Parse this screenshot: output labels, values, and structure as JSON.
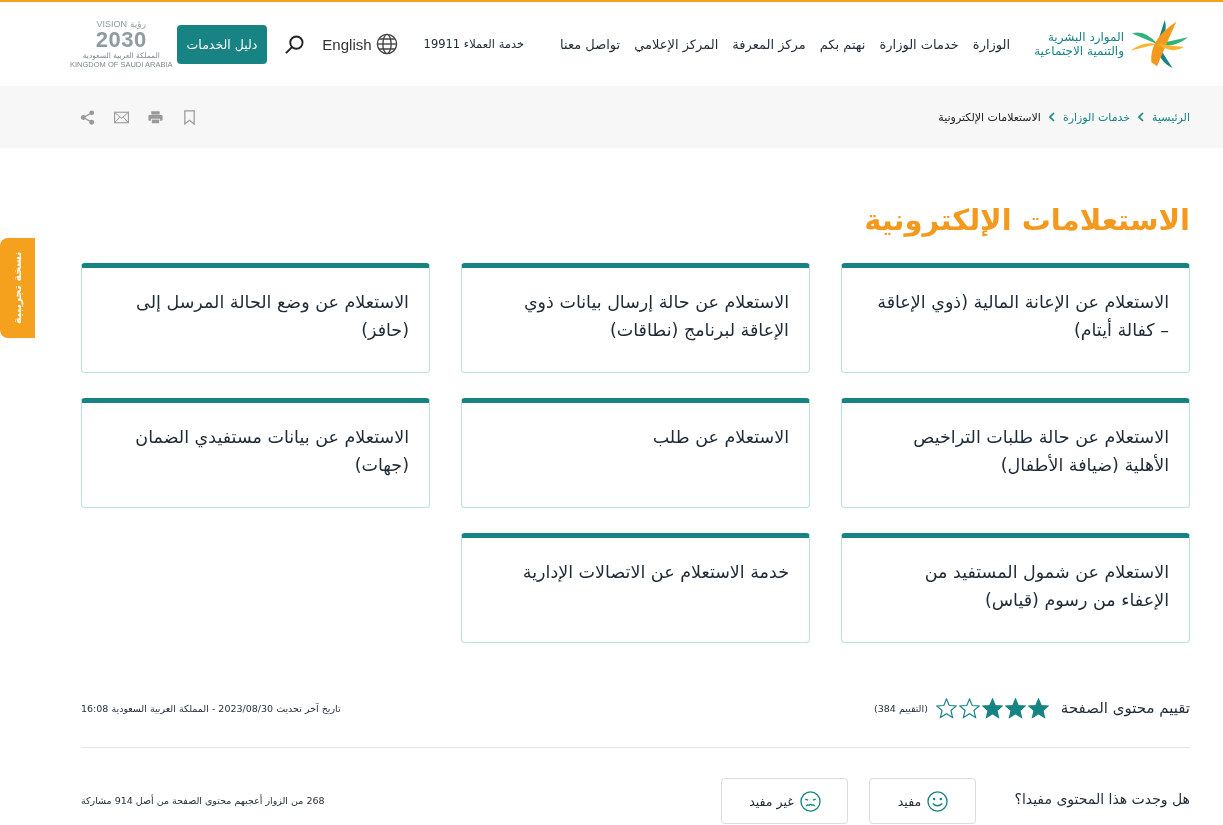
{
  "beta_tab": "نسخة تجريبية",
  "header": {
    "logo_lines": [
      "الموارد البشرية",
      "والتنمية الاجتماعية"
    ],
    "nav": [
      {
        "label": "الوزارة"
      },
      {
        "label": "خدمات الوزارة"
      },
      {
        "label": "نهتم بكم"
      },
      {
        "label": "مركز المعرفة"
      },
      {
        "label": "المركز الإعلامي"
      },
      {
        "label": "تواصل معنا"
      }
    ],
    "customer_service": "خدمة العملاء 19911",
    "language": "English",
    "services_button": "دليل الخدمات",
    "vision_logo": {
      "arabic": "رؤية",
      "latin": "VISION",
      "year": "2030",
      "country_arabic": "المملكة العربية السعودية",
      "country_english": "KINGDOM OF SAUDI ARABIA"
    }
  },
  "breadcrumb": [
    {
      "label": "الرئيسية",
      "current": false
    },
    {
      "label": "خدمات الوزارة",
      "current": false
    },
    {
      "label": "الاستعلامات الإلكترونية",
      "current": true
    }
  ],
  "page_title": "الاستعلامات الإلكترونية",
  "cards": [
    {
      "title": "الاستعلام عن الإعانة المالية (ذوي الإعاقة – كفالة أيتام)"
    },
    {
      "title": "الاستعلام عن حالة إرسال بيانات ذوي الإعاقة لبرنامج (نطاقات)"
    },
    {
      "title": "الاستعلام عن وضع الحالة المرسل إلى (حافز)"
    },
    {
      "title": "الاستعلام عن حالة طلبات التراخيص الأهلية (ضيافة الأطفال)"
    },
    {
      "title": "الاستعلام عن طلب"
    },
    {
      "title": "الاستعلام عن بيانات مستفيدي الضمان (جهات)"
    },
    {
      "title": "الاستعلام عن شمول المستفيد من الإعفاء من رسوم (قياس)"
    },
    {
      "title": "خدمة الاستعلام عن الاتصالات الإدارية"
    }
  ],
  "rating": {
    "label": "تقييم محتوى الصفحة",
    "stars": 3,
    "count": "(التقييم 384)"
  },
  "last_update": "تاريخ آخر تحديث 2023/08/30 - المملكة العربية السعودية 16:08",
  "feedback": {
    "question": "هل وجدت هذا المحتوى مفيدا؟",
    "buttons": [
      {
        "kind": "positive",
        "label": "مفيد"
      },
      {
        "kind": "negative",
        "label": "غير مفيد"
      }
    ],
    "summary": "268 من الزوار أعجبهم محتوى الصفحة من أصل 914 مشاركة"
  }
}
